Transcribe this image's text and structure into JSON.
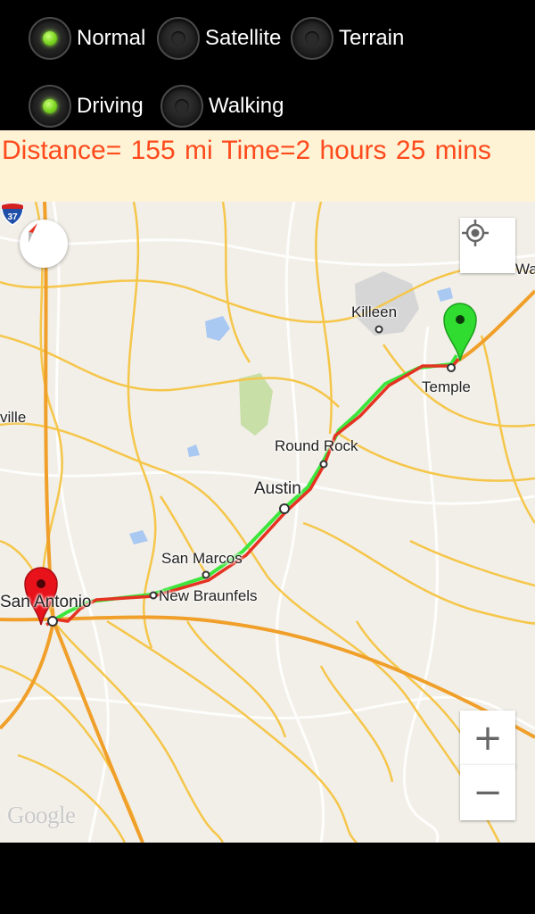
{
  "map_type_options": [
    {
      "label": "Normal",
      "checked": true
    },
    {
      "label": "Satellite",
      "checked": false
    },
    {
      "label": "Terrain",
      "checked": false
    }
  ],
  "travel_mode_options": [
    {
      "label": "Driving",
      "checked": true
    },
    {
      "label": "Walking",
      "checked": false
    }
  ],
  "info": {
    "text": "Distance= 155 mi   Time=2 hours 25 mins"
  },
  "map": {
    "places": {
      "killeen": "Killeen",
      "temple": "Temple",
      "round_rock": "Round Rock",
      "austin": "Austin",
      "san_marcos": "San Marcos",
      "new_braunfels": "New Braunfels",
      "san_antonio": "San Antonio",
      "ville": "ville",
      "wa": "Wa"
    },
    "highway_shield": "37",
    "logo": "Google",
    "zoom_in": "+",
    "zoom_out": "−",
    "colors": {
      "route_driving": "#e53222",
      "route_alt": "#3ce63c",
      "start_marker": "#e8121b",
      "end_marker": "#2fdc2f",
      "info_text": "#ff4a1c",
      "radio_checked": "#7ad31f"
    }
  }
}
